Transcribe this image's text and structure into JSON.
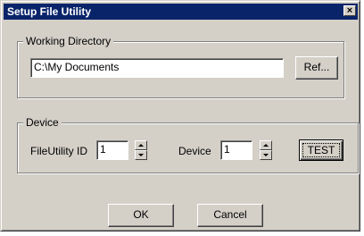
{
  "window": {
    "title": "Setup File Utility",
    "close_icon": "×"
  },
  "working_directory": {
    "group_label": "Working Directory",
    "path_value": "C:\\My Documents",
    "browse_label": "Ref..."
  },
  "device_group": {
    "group_label": "Device",
    "fileutility_id_label": "FileUtility ID",
    "fileutility_id_value": "1",
    "device_label": "Device",
    "device_value": "1",
    "test_label": "TEST"
  },
  "buttons": {
    "ok_label": "OK",
    "cancel_label": "Cancel"
  }
}
